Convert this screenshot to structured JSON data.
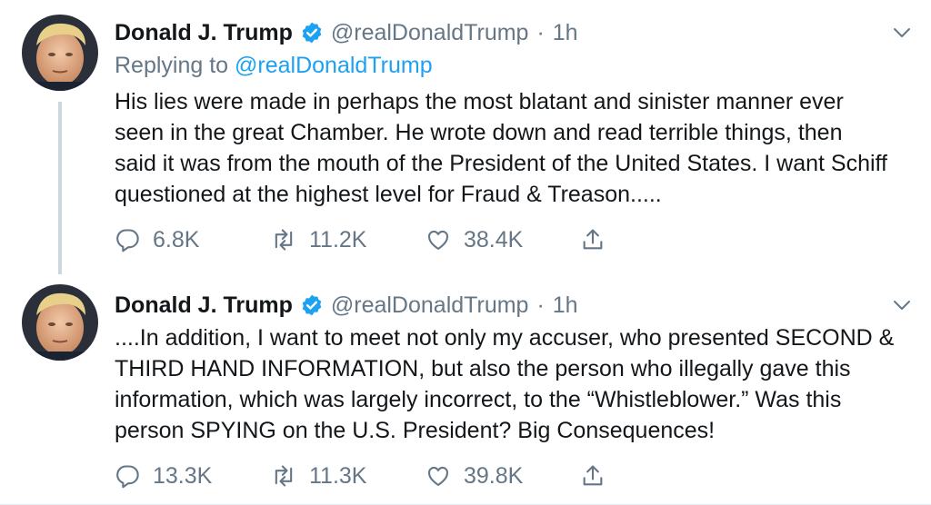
{
  "colors": {
    "text": "#14171a",
    "muted": "#657786",
    "accent": "#1da1f2",
    "thread": "#ccd6dd"
  },
  "tweets": [
    {
      "author": {
        "name": "Donald J. Trump",
        "handle": "@realDonaldTrump",
        "verified": true,
        "avatar": "profile-photo"
      },
      "time": "1h",
      "separator": "·",
      "reply_prefix": "Replying to",
      "reply_handle": "@realDonaldTrump",
      "lines": [
        "His lies were made in perhaps the most blatant and sinister manner ever",
        "seen in the great Chamber. He wrote down and read terrible things, then",
        "said it was from the mouth of the President of the United States. I want Schiff",
        "questioned at the highest level for Fraud & Treason....."
      ],
      "stats": {
        "replies": "6.8K",
        "retweets": "11.2K",
        "likes": "38.4K"
      }
    },
    {
      "author": {
        "name": "Donald J. Trump",
        "handle": "@realDonaldTrump",
        "verified": true,
        "avatar": "profile-photo"
      },
      "time": "1h",
      "separator": "·",
      "lines": [
        "....In addition, I want to meet not only my accuser, who presented SECOND &",
        "THIRD HAND INFORMATION, but also the person who illegally gave this",
        "information, which was largely incorrect, to the “Whistleblower.” Was this",
        "person SPYING on the U.S. President? Big Consequences!"
      ],
      "stats": {
        "replies": "13.3K",
        "retweets": "11.3K",
        "likes": "39.8K"
      }
    }
  ],
  "icons": {
    "reply": "reply-icon",
    "retweet": "retweet-icon",
    "like": "heart-icon",
    "share": "share-icon",
    "caret": "chevron-down-icon",
    "verified": "verified-badge-icon"
  }
}
